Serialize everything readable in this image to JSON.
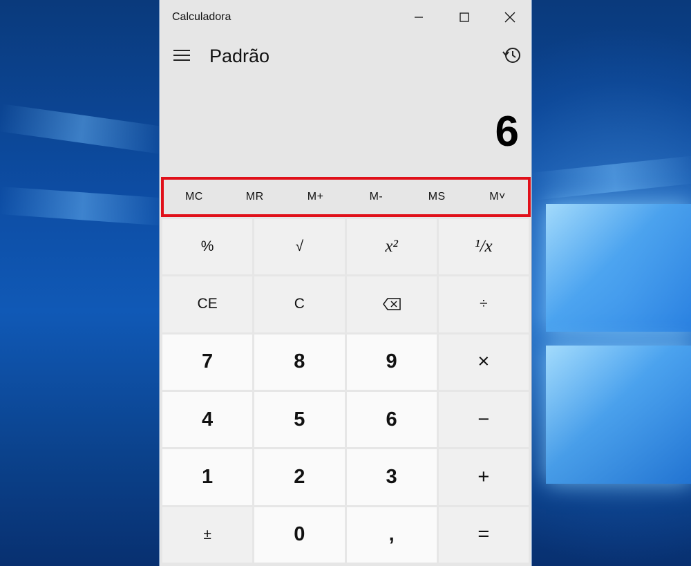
{
  "window": {
    "title": "Calculadora",
    "controls": {
      "minimize": "minimize-icon",
      "maximize": "maximize-icon",
      "close": "close-icon"
    }
  },
  "header": {
    "mode": "Padrão",
    "history_icon": "history-icon",
    "menu_icon": "hamburger-icon"
  },
  "display": {
    "value": "6"
  },
  "memory": {
    "buttons": [
      "MC",
      "MR",
      "M+",
      "M-",
      "MS",
      "M˅"
    ],
    "highlight_color": "#e0101a"
  },
  "keypad": {
    "rows": [
      [
        "%",
        "√",
        "x²",
        "¹/x"
      ],
      [
        "CE",
        "C",
        "⌫",
        "÷"
      ],
      [
        "7",
        "8",
        "9",
        "×"
      ],
      [
        "4",
        "5",
        "6",
        "−"
      ],
      [
        "1",
        "2",
        "3",
        "+"
      ],
      [
        "±",
        "0",
        ",",
        "="
      ]
    ]
  }
}
